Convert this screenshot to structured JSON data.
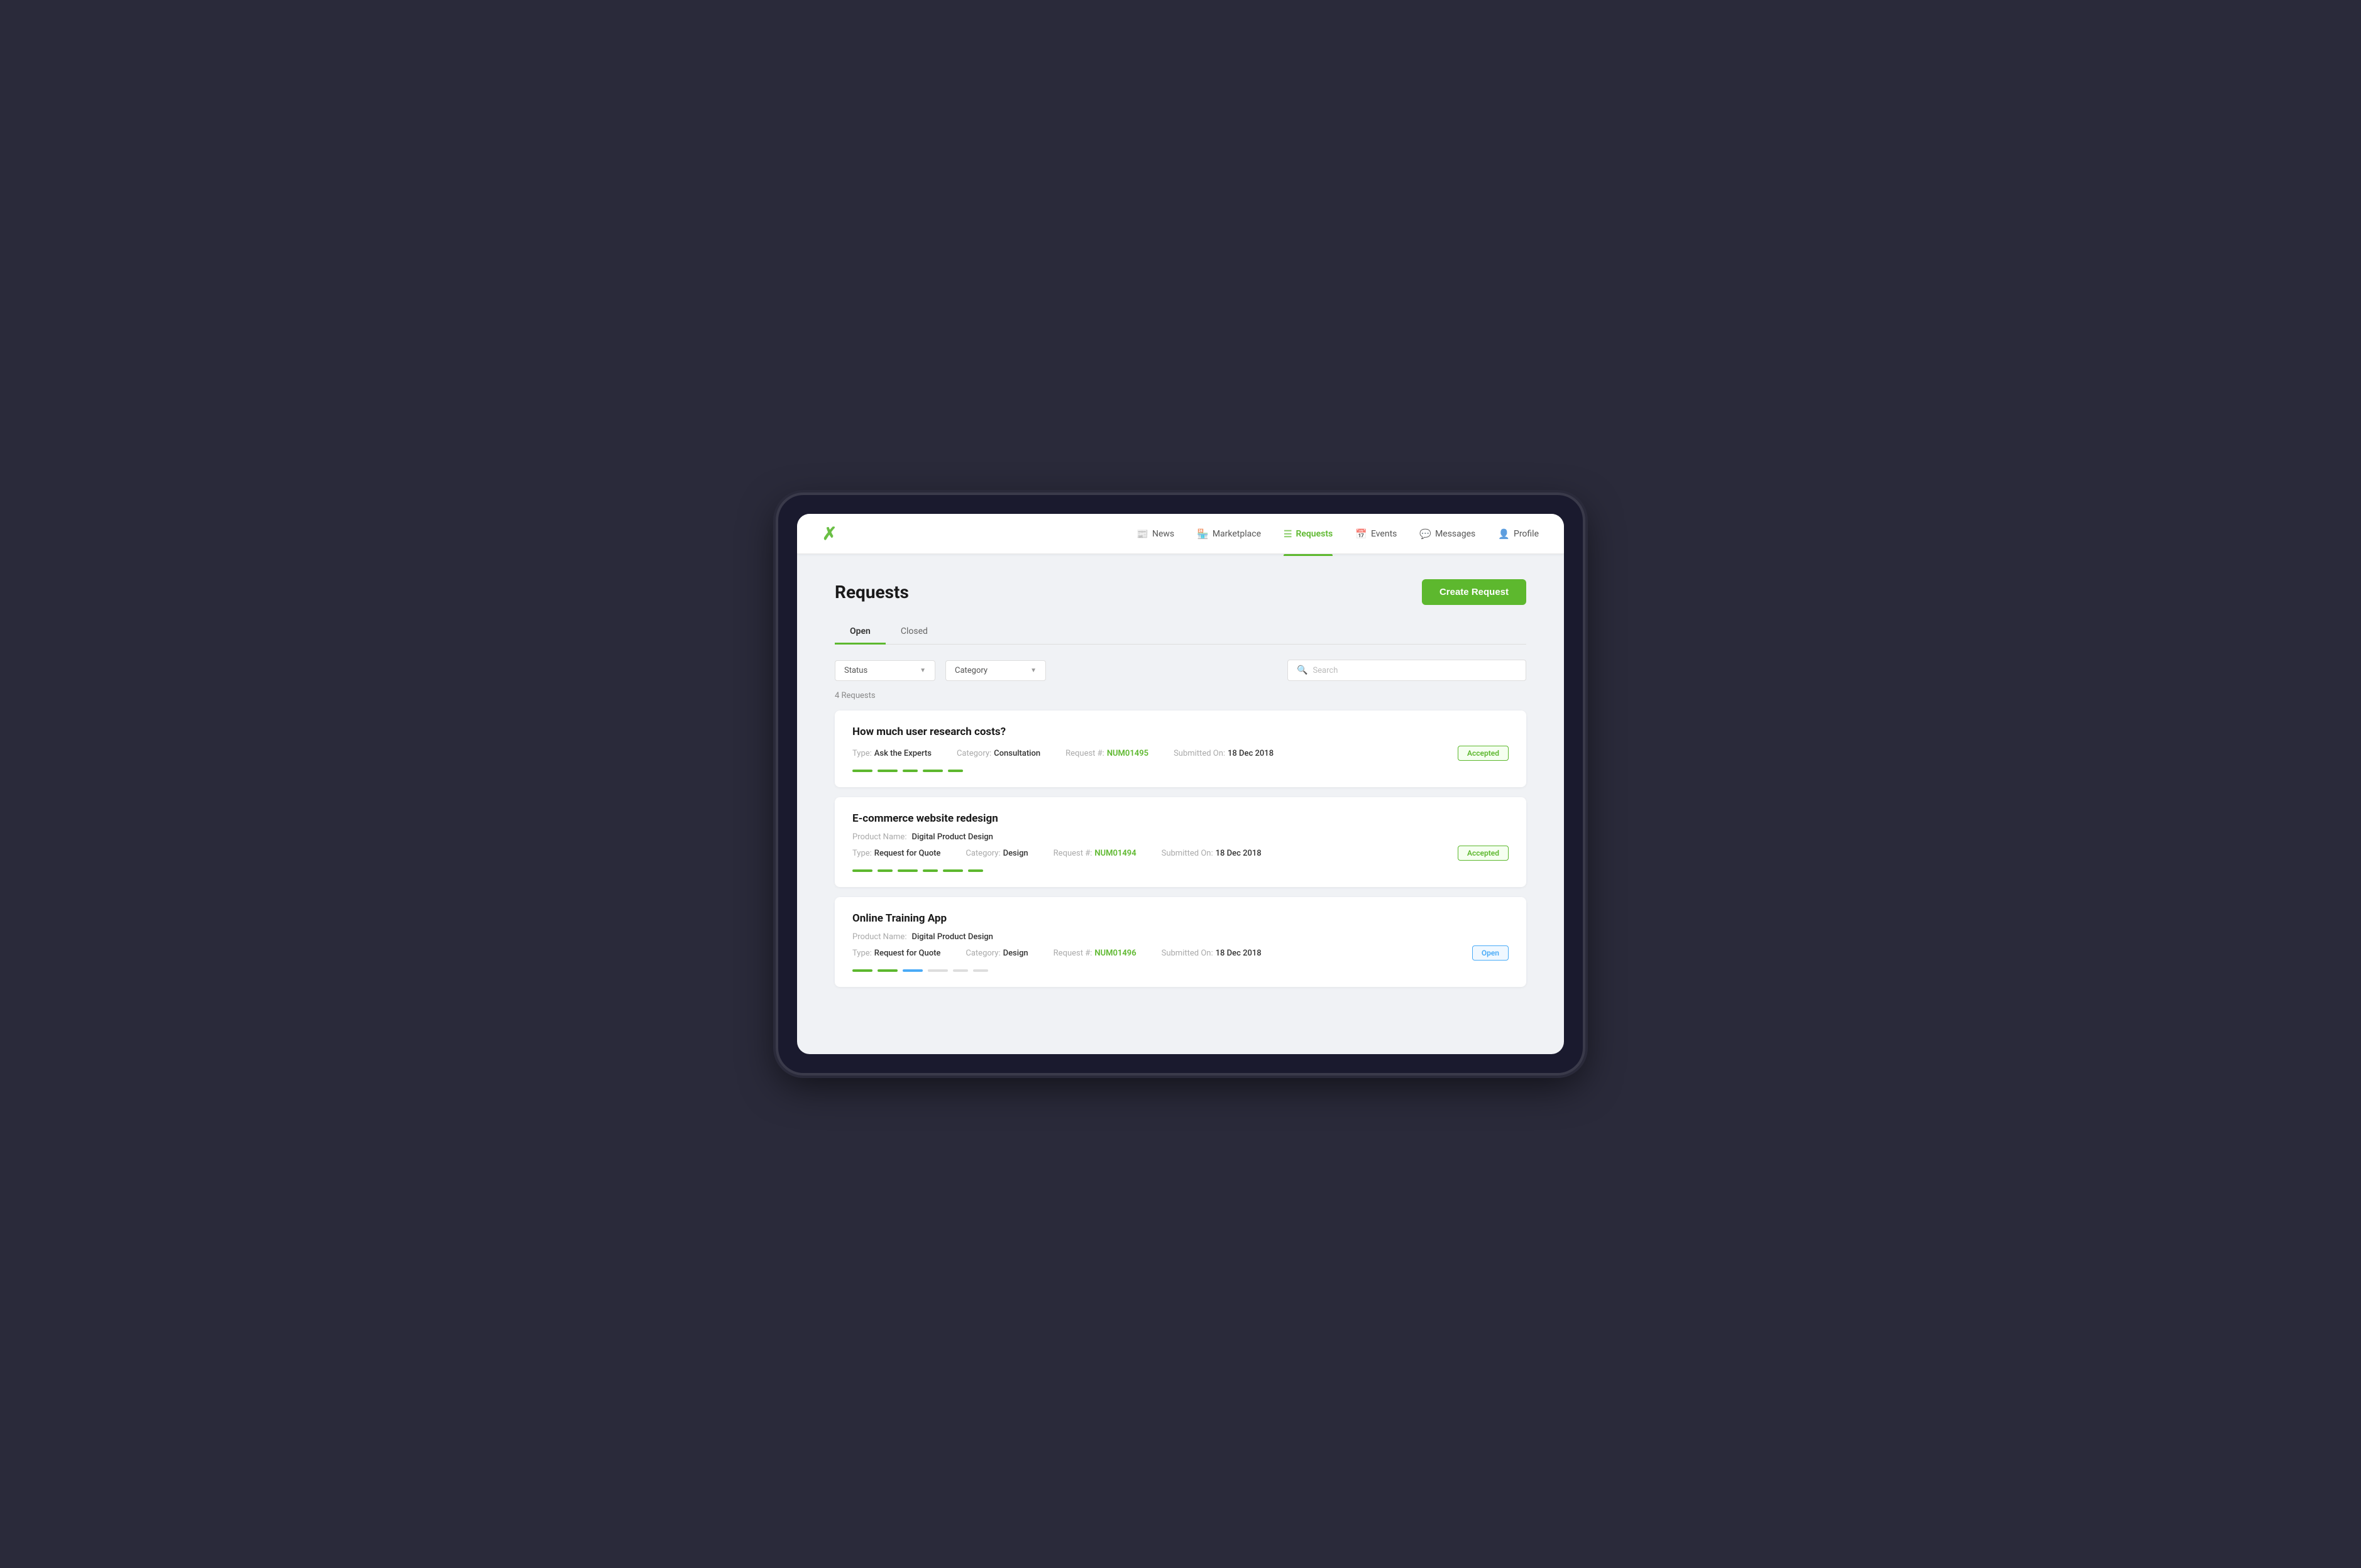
{
  "logo": "✕",
  "nav": {
    "items": [
      {
        "label": "News",
        "icon": "📰",
        "active": false
      },
      {
        "label": "Marketplace",
        "icon": "🏪",
        "active": false
      },
      {
        "label": "Requests",
        "icon": "≡",
        "active": true
      },
      {
        "label": "Events",
        "icon": "📅",
        "active": false
      },
      {
        "label": "Messages",
        "icon": "💬",
        "active": false
      },
      {
        "label": "Profile",
        "icon": "👤",
        "active": false
      }
    ]
  },
  "page": {
    "title": "Requests",
    "create_button": "Create Request",
    "tabs": [
      "Open",
      "Closed"
    ],
    "active_tab": "Open",
    "filters": {
      "status_placeholder": "Status",
      "category_placeholder": "Category",
      "search_placeholder": "Search"
    },
    "count_label": "4 Requests",
    "requests": [
      {
        "title": "How much user research costs?",
        "product_name": null,
        "type_label": "Type:",
        "type_value": "Ask the Experts",
        "category_label": "Category:",
        "category_value": "Consultation",
        "request_label": "Request #:",
        "request_value": "NUM01495",
        "submitted_label": "Submitted On:",
        "submitted_value": "18 Dec 2018",
        "badge": "Accepted",
        "badge_type": "accepted",
        "progress": [
          "green",
          "green",
          "green",
          "green",
          "green"
        ]
      },
      {
        "title": "E-commerce website redesign",
        "product_name": "Digital Product Design",
        "type_label": "Type:",
        "type_value": "Request for Quote",
        "category_label": "Category:",
        "category_value": "Design",
        "request_label": "Request #:",
        "request_value": "NUM01494",
        "submitted_label": "Submitted On:",
        "submitted_value": "18 Dec 2018",
        "badge": "Accepted",
        "badge_type": "accepted",
        "progress": [
          "green",
          "green",
          "green",
          "green",
          "green",
          "green"
        ]
      },
      {
        "title": "Online Training App",
        "product_name": "Digital Product Design",
        "type_label": "Type:",
        "type_value": "Request for Quote",
        "category_label": "Category:",
        "category_value": "Design",
        "request_label": "Request #:",
        "request_value": "NUM01496",
        "submitted_label": "Submitted On:",
        "submitted_value": "18 Dec 2018",
        "badge": "Open",
        "badge_type": "open",
        "progress": [
          "green",
          "green",
          "blue",
          "gray",
          "gray",
          "gray"
        ]
      }
    ]
  }
}
